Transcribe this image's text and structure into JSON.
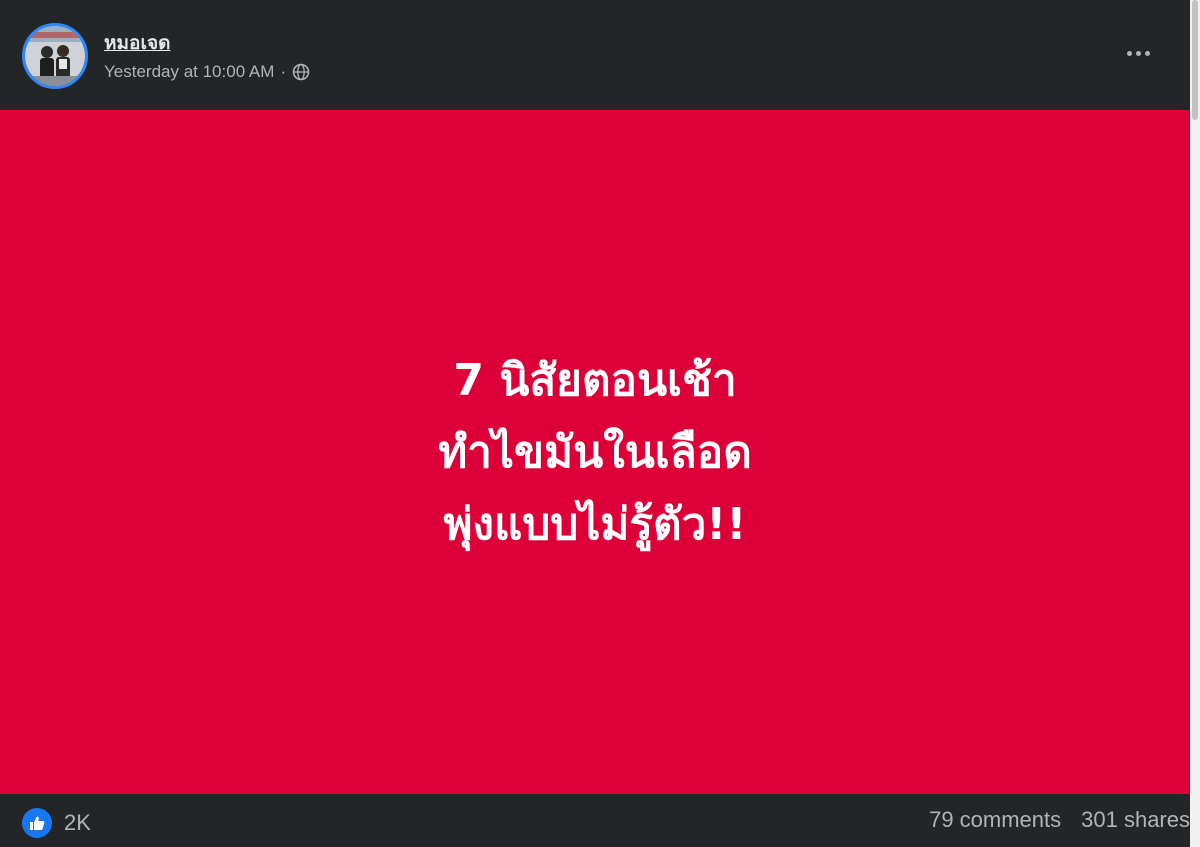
{
  "post": {
    "author": "หมอเจด",
    "timestamp": "Yesterday at 10:00 AM",
    "separator": "·",
    "privacy_icon": "globe-icon",
    "more_icon": "more-options-icon"
  },
  "image": {
    "background_color": "#dd0038",
    "text_color": "#ffffff",
    "lines": [
      "7 นิสัยตอนเช้า",
      "ทำไขมันในเลือด",
      "พุ่งแบบไม่รู้ตัว!!"
    ]
  },
  "footer": {
    "reaction_icon": "like-icon",
    "reaction_count": "2K",
    "comments": "79 comments",
    "shares": "301 shares"
  },
  "colors": {
    "card_bg": "#242526",
    "secondary_text": "#b0b3b8",
    "accent": "#1877f2"
  }
}
